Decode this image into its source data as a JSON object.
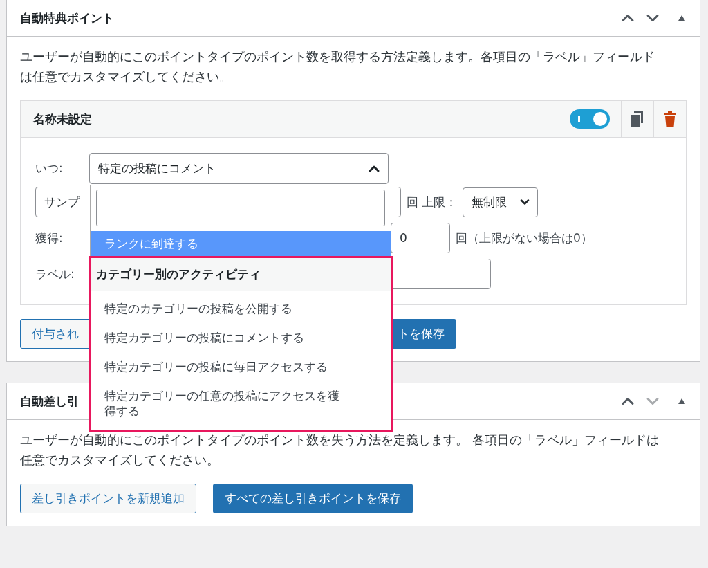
{
  "panels": [
    {
      "title": "自動特典ポイント",
      "move_down_disabled": false,
      "description": "ユーザーが自動的にこのポイントタイプのポイント数を取得する方法定義します。各項目の「ラベル」フィールドは任意でカスタマイズしてください。",
      "card": {
        "title": "名称未設定",
        "enabled": true,
        "when": {
          "label": "いつ:",
          "value": "特定の投稿にコメント",
          "expanded": true
        },
        "points": {
          "value": "サンプ",
          "unit": "回 上限：",
          "limit": "無制限"
        },
        "earn": {
          "label": "獲得:",
          "value": "0",
          "note": "回（上限がない場合は0）"
        },
        "label_row": {
          "label": "ラベル:"
        },
        "dropdown": {
          "options": [
            {
              "label": "ランクに到達する",
              "highlighted": true
            }
          ],
          "groups": [
            {
              "label": "カテゴリー別のアクティビティ",
              "outlined": true,
              "options": [
                {
                  "label": "特定のカテゴリーの投稿を公開する",
                  "highlighted": false
                },
                {
                  "label": "特定カテゴリーの投稿にコメントする",
                  "highlighted": false
                },
                {
                  "label": "特定カテゴリーの投稿に毎日アクセスする",
                  "highlighted": false
                },
                {
                  "label": "特定カテゴリーの任意の投稿にアクセスを獲得する",
                  "highlighted": false
                }
              ]
            }
          ]
        }
      },
      "buttons": [
        {
          "label": "付与され",
          "kind": "secondary"
        },
        {
          "label": "トを保存",
          "kind": "primary"
        }
      ]
    },
    {
      "title": "自動差し引",
      "move_down_disabled": true,
      "description": "ユーザーが自動的にこのポイントタイプのポイント数を失う方法を定義します。 各項目の「ラベル」フィールドは任意でカスタマイズしてください。",
      "buttons": [
        {
          "label": "差し引きポイントを新規追加",
          "kind": "secondary"
        },
        {
          "label": "すべての差し引きポイントを保存",
          "kind": "primary"
        }
      ]
    }
  ]
}
